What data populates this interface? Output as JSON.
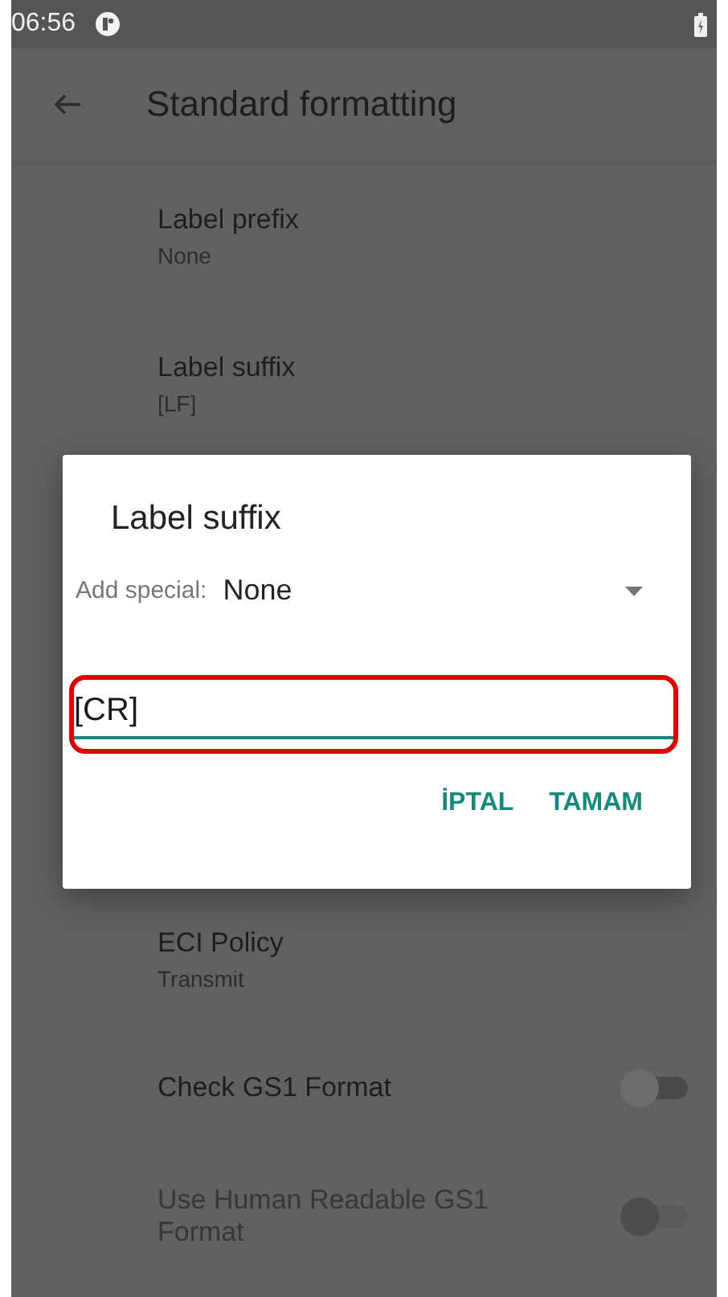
{
  "status_bar": {
    "time": "06:56"
  },
  "app_bar": {
    "title": "Standard formatting"
  },
  "settings": [
    {
      "kind": "text",
      "title": "Label prefix",
      "summary": "None",
      "disabled": false
    },
    {
      "kind": "text",
      "title": "Label suffix",
      "summary": "[LF]",
      "disabled": false
    },
    {
      "kind": "text",
      "title": "ECI Policy",
      "summary": "Transmit",
      "disabled": false
    },
    {
      "kind": "switch",
      "title": "Check GS1 Format",
      "on": false,
      "disabled": false
    },
    {
      "kind": "switch",
      "title": "Use Human Readable GS1 Format",
      "on": false,
      "disabled": true
    }
  ],
  "dialog": {
    "title": "Label suffix",
    "special_label": "Add special:",
    "special_value": "None",
    "field_value": "[CR]",
    "highlighted": true,
    "buttons": [
      "İPTAL",
      "TAMAM"
    ]
  }
}
